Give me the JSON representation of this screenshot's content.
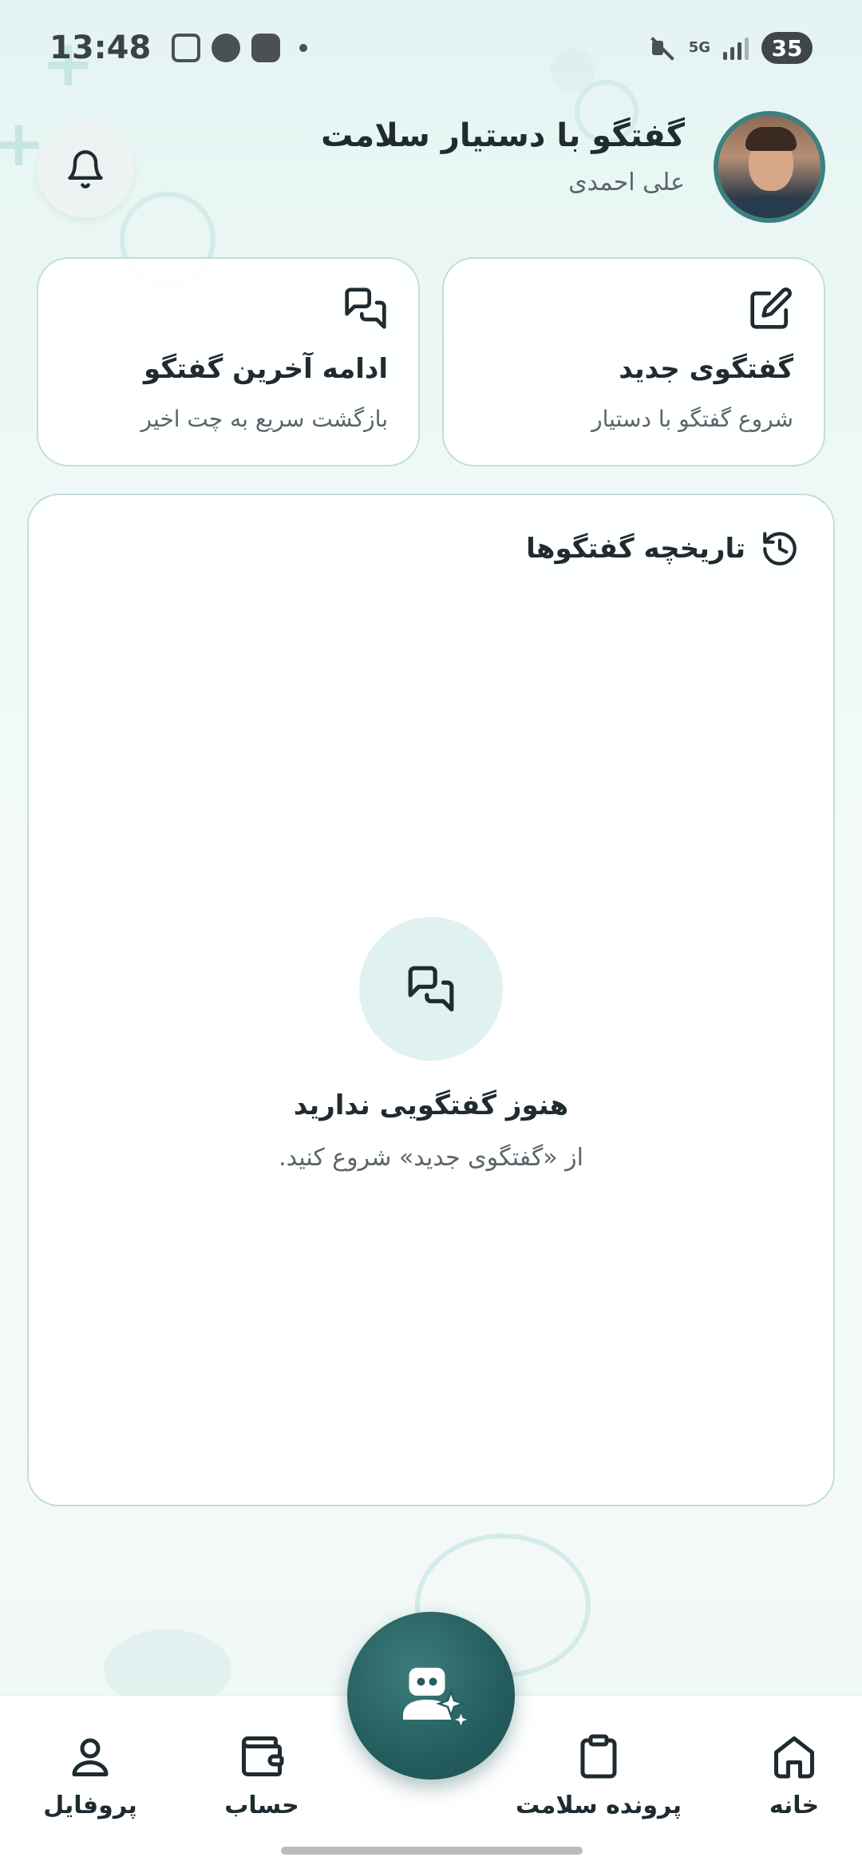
{
  "status_bar": {
    "time": "13:48",
    "network": "5G",
    "battery": "35"
  },
  "header": {
    "title": "گفتگو با دستیار سلامت",
    "user_name": "علی احمدی"
  },
  "cards": {
    "new_chat": {
      "title": "گفتگوی جدید",
      "subtitle": "شروع گفتگو با دستیار",
      "icon": "edit-icon"
    },
    "resume_chat": {
      "title": "ادامه آخرین گفتگو",
      "subtitle": "بازگشت سریع به چت اخیر",
      "icon": "chat-bubbles-icon"
    }
  },
  "history": {
    "title": "تاریخچه گفتگوها",
    "empty_title": "هنوز گفتگویی ندارید",
    "empty_subtitle": "از «گفتگوی جدید» شروع کنید."
  },
  "bottom_nav": {
    "home": "خانه",
    "health_records": "پرونده سلامت",
    "account": "حساب",
    "profile": "پروفایل"
  },
  "colors": {
    "accent": "#245d5e",
    "card_border": "#bfdedc",
    "background": "#edf8f6"
  }
}
